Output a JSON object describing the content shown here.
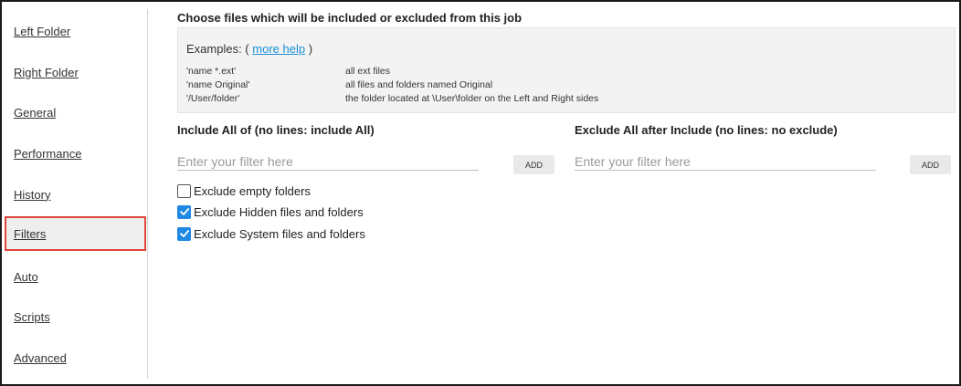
{
  "sidebar": {
    "items": [
      {
        "label": "Left Folder",
        "selected": false
      },
      {
        "label": "Right Folder",
        "selected": false
      },
      {
        "label": "General",
        "selected": false
      },
      {
        "label": "Performance",
        "selected": false
      },
      {
        "label": "History",
        "selected": false
      },
      {
        "label": "Filters",
        "selected": true
      },
      {
        "label": "Auto",
        "selected": false
      },
      {
        "label": "Scripts",
        "selected": false
      },
      {
        "label": "Advanced",
        "selected": false
      }
    ]
  },
  "main": {
    "heading": "Choose files which will be included or excluded from this job",
    "examples": {
      "prefix": "Examples: (",
      "link": "more help",
      "suffix": ")",
      "rows": [
        {
          "pattern": "'name *.ext'",
          "description": "all ext files"
        },
        {
          "pattern": "'name Original'",
          "description": "all files and folders named Original"
        },
        {
          "pattern": "'/User/folder'",
          "description": "the folder located at \\User\\folder on the Left and Right sides"
        }
      ]
    },
    "include": {
      "title": "Include All of (no lines: include All)",
      "placeholder": "Enter your filter here",
      "add_label": "ADD"
    },
    "exclude": {
      "title": "Exclude All after Include (no lines: no exclude)",
      "placeholder": "Enter your filter here",
      "add_label": "ADD"
    },
    "options": [
      {
        "label": "Exclude empty folders",
        "checked": false
      },
      {
        "label": "Exclude Hidden files and folders",
        "checked": true
      },
      {
        "label": "Exclude System files and folders",
        "checked": true
      }
    ]
  },
  "colors": {
    "accent": "#1e88e5",
    "link": "#1a8fd6",
    "selected_border": "#e0453a"
  }
}
